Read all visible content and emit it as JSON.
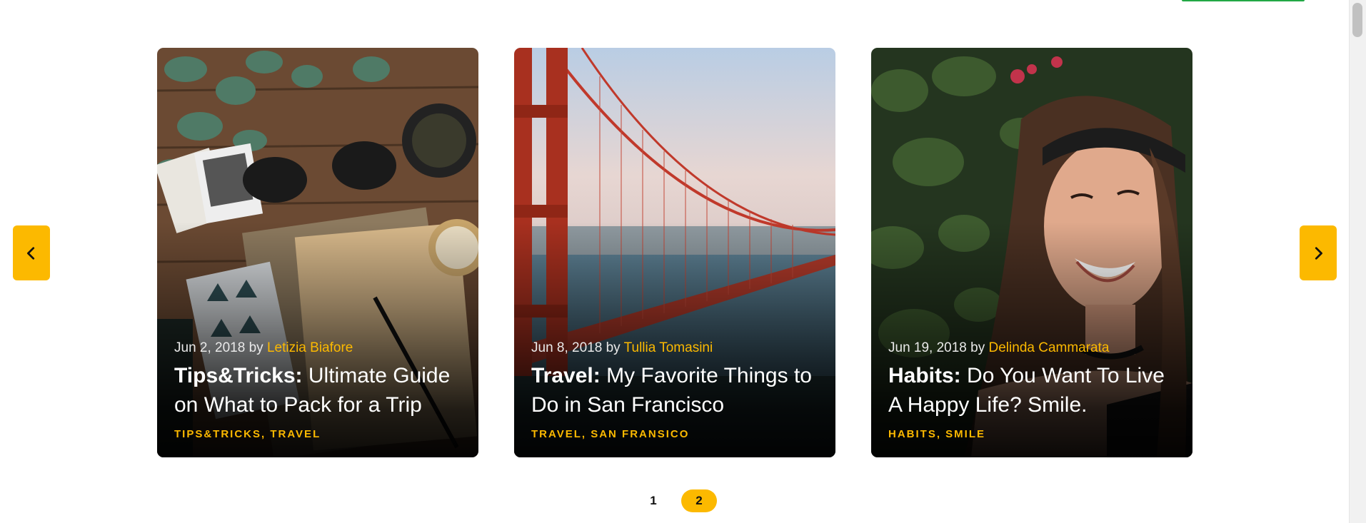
{
  "carousel": {
    "prev_icon": "chevron-left-icon",
    "next_icon": "chevron-right-icon",
    "accent_color": "#fcb900",
    "cards": [
      {
        "date": "Jun 2, 2018",
        "by": "by",
        "author": "Letizia Biafore",
        "category": "Tips&Tricks:",
        "title": "Ultimate Guide on What to Pack for a Trip",
        "tags": "TIPS&TRICKS, TRAVEL",
        "image": "travel-flatlay-photo"
      },
      {
        "date": "Jun 8, 2018",
        "by": "by",
        "author": "Tullia Tomasini",
        "category": "Travel:",
        "title": "My Favorite Things to Do in San Francisco",
        "tags": "TRAVEL, SAN FRANSICO",
        "image": "golden-gate-bridge-photo"
      },
      {
        "date": "Jun 19, 2018",
        "by": "by",
        "author": "Delinda Cammarata",
        "category": "Habits:",
        "title": "Do You Want To Live A Happy Life? Smile.",
        "tags": "HABITS, SMILE",
        "image": "smiling-woman-photo"
      }
    ]
  },
  "pagination": {
    "pages": [
      "1",
      "2"
    ],
    "active": "2"
  }
}
